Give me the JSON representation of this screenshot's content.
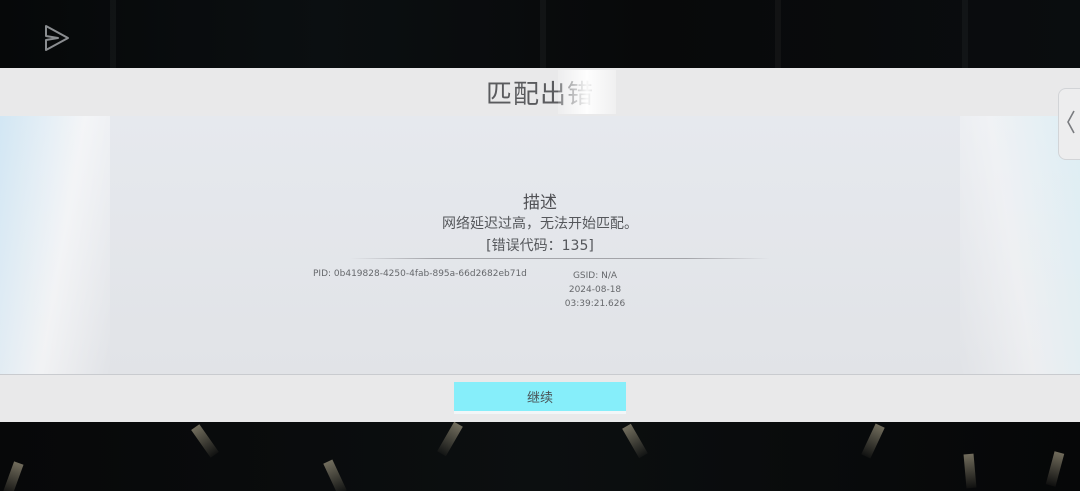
{
  "dialog": {
    "title": "匹配出错",
    "heading": "描述",
    "message": "网络延迟过高，无法开始匹配。",
    "error_code": "[错误代码：135]",
    "pid": "PID: 0b419828-4250-4fab-895a-66d2682eb71d",
    "gsid": "GSID: N/A",
    "date": "2024-08-18",
    "time": "03:39:21.626",
    "continue_label": "继续"
  },
  "icons": {
    "share": "send-arrow-icon",
    "side": "chevron-left-icon"
  },
  "colors": {
    "button": "#86eefa",
    "dialog_bg": "#e9e9ea",
    "backdrop": "#050708"
  }
}
